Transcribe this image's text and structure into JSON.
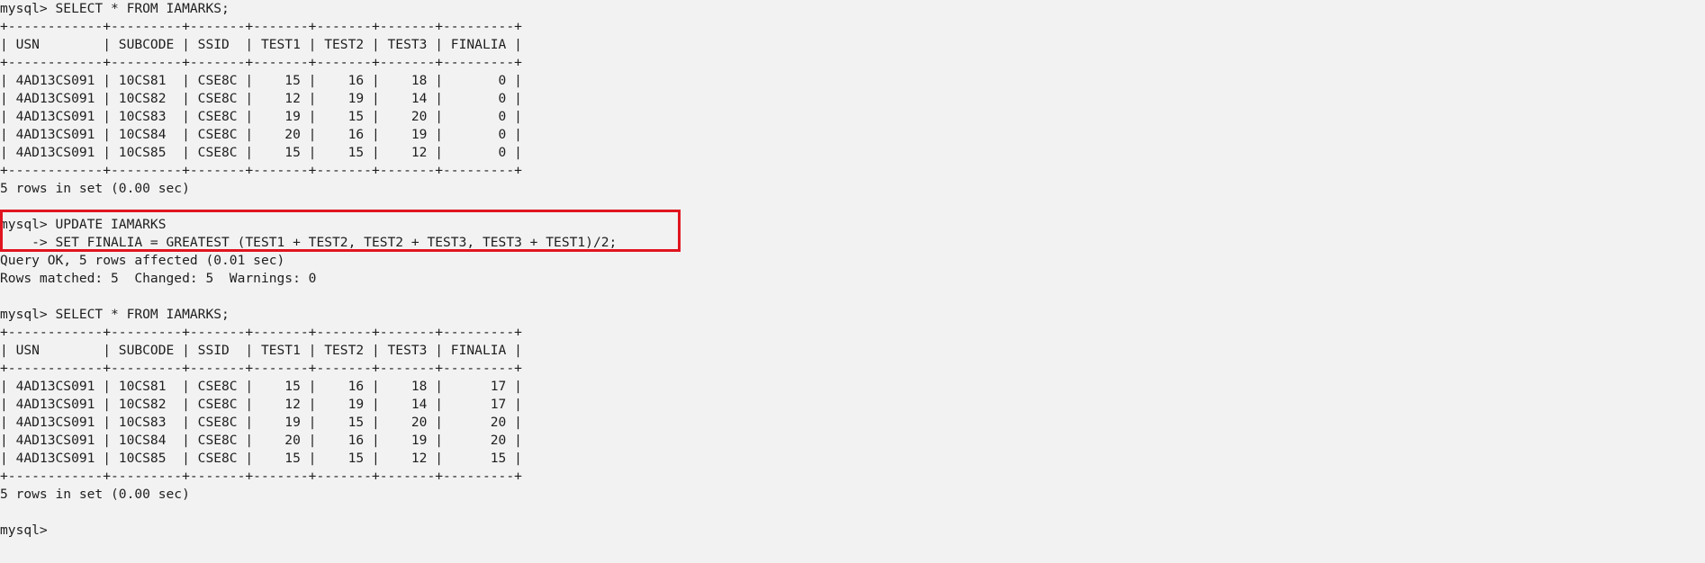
{
  "terminal": {
    "lines": [
      "mysql> SELECT * FROM IAMARKS;",
      "+------------+---------+-------+-------+-------+-------+---------+",
      "| USN        | SUBCODE | SSID  | TEST1 | TEST2 | TEST3 | FINALIA |",
      "+------------+---------+-------+-------+-------+-------+---------+",
      "| 4AD13CS091 | 10CS81  | CSE8C |    15 |    16 |    18 |       0 |",
      "| 4AD13CS091 | 10CS82  | CSE8C |    12 |    19 |    14 |       0 |",
      "| 4AD13CS091 | 10CS83  | CSE8C |    19 |    15 |    20 |       0 |",
      "| 4AD13CS091 | 10CS84  | CSE8C |    20 |    16 |    19 |       0 |",
      "| 4AD13CS091 | 10CS85  | CSE8C |    15 |    15 |    12 |       0 |",
      "+------------+---------+-------+-------+-------+-------+---------+",
      "5 rows in set (0.00 sec)",
      "",
      "mysql> UPDATE IAMARKS",
      "    -> SET FINALIA = GREATEST (TEST1 + TEST2, TEST2 + TEST3, TEST3 + TEST1)/2;",
      "Query OK, 5 rows affected (0.01 sec)",
      "Rows matched: 5  Changed: 5  Warnings: 0",
      "",
      "mysql> SELECT * FROM IAMARKS;",
      "+------------+---------+-------+-------+-------+-------+---------+",
      "| USN        | SUBCODE | SSID  | TEST1 | TEST2 | TEST3 | FINALIA |",
      "+------------+---------+-------+-------+-------+-------+---------+",
      "| 4AD13CS091 | 10CS81  | CSE8C |    15 |    16 |    18 |      17 |",
      "| 4AD13CS091 | 10CS82  | CSE8C |    12 |    19 |    14 |      17 |",
      "| 4AD13CS091 | 10CS83  | CSE8C |    19 |    15 |    20 |      20 |",
      "| 4AD13CS091 | 10CS84  | CSE8C |    20 |    16 |    19 |      20 |",
      "| 4AD13CS091 | 10CS85  | CSE8C |    15 |    15 |    12 |      15 |",
      "+------------+---------+-------+-------+-------+-------+---------+",
      "5 rows in set (0.00 sec)",
      "",
      "mysql>"
    ]
  },
  "highlight": {
    "color": "#e0151f"
  }
}
